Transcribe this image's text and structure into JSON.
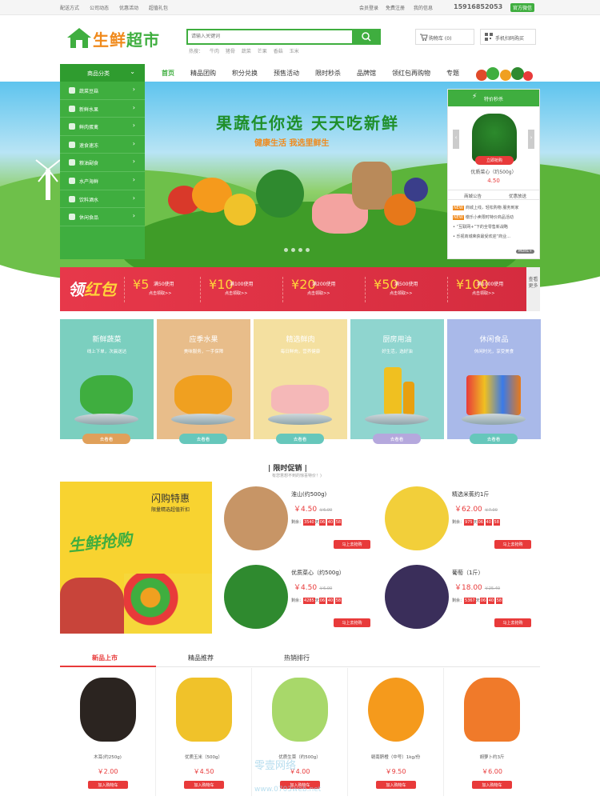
{
  "topbar": {
    "links": [
      "配送方式",
      "公司动态",
      "优惠活动",
      "超值礼包"
    ],
    "login": "会员登录",
    "register": "免费注册",
    "my": "我的信息",
    "phone": "15916852053",
    "wechat": "官方微信"
  },
  "logo": {
    "text_a": "生鲜",
    "text_b": "超市"
  },
  "search": {
    "placeholder": "请输入关键词",
    "hot_label": "热搜：",
    "hot": [
      "牛肉",
      "猪骨",
      "蔬菜",
      "芒果",
      "香菇",
      "玉米"
    ]
  },
  "header": {
    "cart": "购物车 (0)",
    "app": "手机扫码购买"
  },
  "category": {
    "title": "商品分类",
    "items": [
      "蔬菜豆菇",
      "新鲜水果",
      "鲜肉蛋禽",
      "速食速冻",
      "粮油副食",
      "水产海鲜",
      "饮料酒水",
      "休闲食品"
    ]
  },
  "nav": {
    "items": [
      "首页",
      "精品团购",
      "积分兑换",
      "预售活动",
      "限时秒杀",
      "品牌馆",
      "领红包再购物",
      "专题"
    ]
  },
  "banner": {
    "title": "果蔬任你选 天天吃新鲜",
    "subtitle": "健康生活 我选里鲜生"
  },
  "sidebar": {
    "head": "特价秒杀",
    "buy": "立即抢购",
    "name": "优质菜心（约500g）",
    "price": "4.50",
    "tabs": [
      "商城公告",
      "优惠放送"
    ],
    "news": [
      {
        "new": "NEW",
        "text": "商城上线，轻松购物 服务到家"
      },
      {
        "new": "NEW",
        "text": "缴乐小卖限时特价商品活动"
      },
      {
        "new": "",
        "text": "“互联网+”下的全零售新战略"
      },
      {
        "new": "",
        "text": "乐视商城荣获最受欢迎“商业..."
      }
    ],
    "more": "MORE+"
  },
  "coupon": {
    "logo_a": "领",
    "logo_b": "红包",
    "items": [
      {
        "amount": "5",
        "cond": "满50使用",
        "get": "点击领取>>"
      },
      {
        "amount": "10",
        "cond": "满100使用",
        "get": "点击领取>>"
      },
      {
        "amount": "20",
        "cond": "满200使用",
        "get": "点击领取>>"
      },
      {
        "amount": "50",
        "cond": "满500使用",
        "get": "点击领取>>"
      },
      {
        "amount": "100",
        "cond": "满1000使用",
        "get": "点击领取>>"
      }
    ],
    "more": "查看更多"
  },
  "categories": [
    {
      "title": "新鲜蔬菜",
      "desc": "线上下单，次晨送达",
      "btn": "去看看",
      "bg": "#7bcfbf",
      "btncolor": "#e0a05a"
    },
    {
      "title": "应季水果",
      "desc": "美味服务，一手保障",
      "btn": "去看看",
      "bg": "#e8bd8a",
      "btncolor": "#66c7bb"
    },
    {
      "title": "精选鲜肉",
      "desc": "每日鲜肉，营养健康",
      "btn": "去看看",
      "bg": "#f4e0a0",
      "btncolor": "#66c7bb"
    },
    {
      "title": "厨房用油",
      "desc": "好生活，选好油",
      "btn": "去看看",
      "bg": "#8fd5cf",
      "btncolor": "#b5a8dd"
    },
    {
      "title": "休闲食品",
      "desc": "休闲时光，享受美食",
      "btn": "去看看",
      "bg": "#a9b9e9",
      "btncolor": "#66c7bb"
    }
  ],
  "flash_section": {
    "title": "限时促销",
    "subtitle": "有您意想不到的惊喜特价！)"
  },
  "flash": {
    "title": "闪购特惠",
    "subtitle": "限量精选超值折扣",
    "art": "生鲜抢购"
  },
  "promos": [
    {
      "name": "淮山(约500g)",
      "price": "￥4.50",
      "old": "￥6.00",
      "left": "剩余：",
      "d": "3540",
      "h": "06",
      "m": "40",
      "s": "58",
      "day": "天",
      "go": "马上去抢购",
      "color": "#c79566"
    },
    {
      "name": "精选米蕉约1斤",
      "price": "￥62.00",
      "old": "￥7.00",
      "left": "剩余：",
      "d": "975",
      "h": "06",
      "m": "40",
      "s": "58",
      "day": "天",
      "go": "马上去抢购",
      "color": "#f2cf3a"
    },
    {
      "name": "优质菜心（约500g）",
      "price": "￥4.50",
      "old": "￥6.00",
      "left": "剩余：",
      "d": "4285",
      "h": "06",
      "m": "40",
      "s": "58",
      "day": "天",
      "go": "马上去抢购",
      "color": "#2f8a2f"
    },
    {
      "name": "葡萄（1斤）",
      "price": "￥18.00",
      "old": "￥25.40",
      "left": "剩余：",
      "d": "5367",
      "h": "06",
      "m": "40",
      "s": "58",
      "day": "天",
      "go": "马上去抢购",
      "color": "#3a2e5a"
    }
  ],
  "tabs": [
    "新品上市",
    "精品推荐",
    "热销排行"
  ],
  "products": [
    {
      "name": "木耳(约250g)",
      "price": "￥2.00",
      "add": "加入购物车",
      "color": "#2b2420"
    },
    {
      "name": "优质玉米（500g）",
      "price": "￥4.50",
      "add": "加入购物车",
      "color": "#f0c22a"
    },
    {
      "name": "优质生菜（约500g）",
      "price": "￥4.00",
      "add": "加入购物车",
      "color": "#a8d86a"
    },
    {
      "name": "赣南脐橙（中号）1kg/份",
      "price": "￥9.50",
      "add": "加入购物车",
      "color": "#f59a1c"
    },
    {
      "name": "胡萝卜约3斤",
      "price": "￥6.00",
      "add": "加入购物车",
      "color": "#f07a2a"
    }
  ],
  "watermark": {
    "line1": "零壹网络",
    "line2": "www.0703web.net"
  }
}
